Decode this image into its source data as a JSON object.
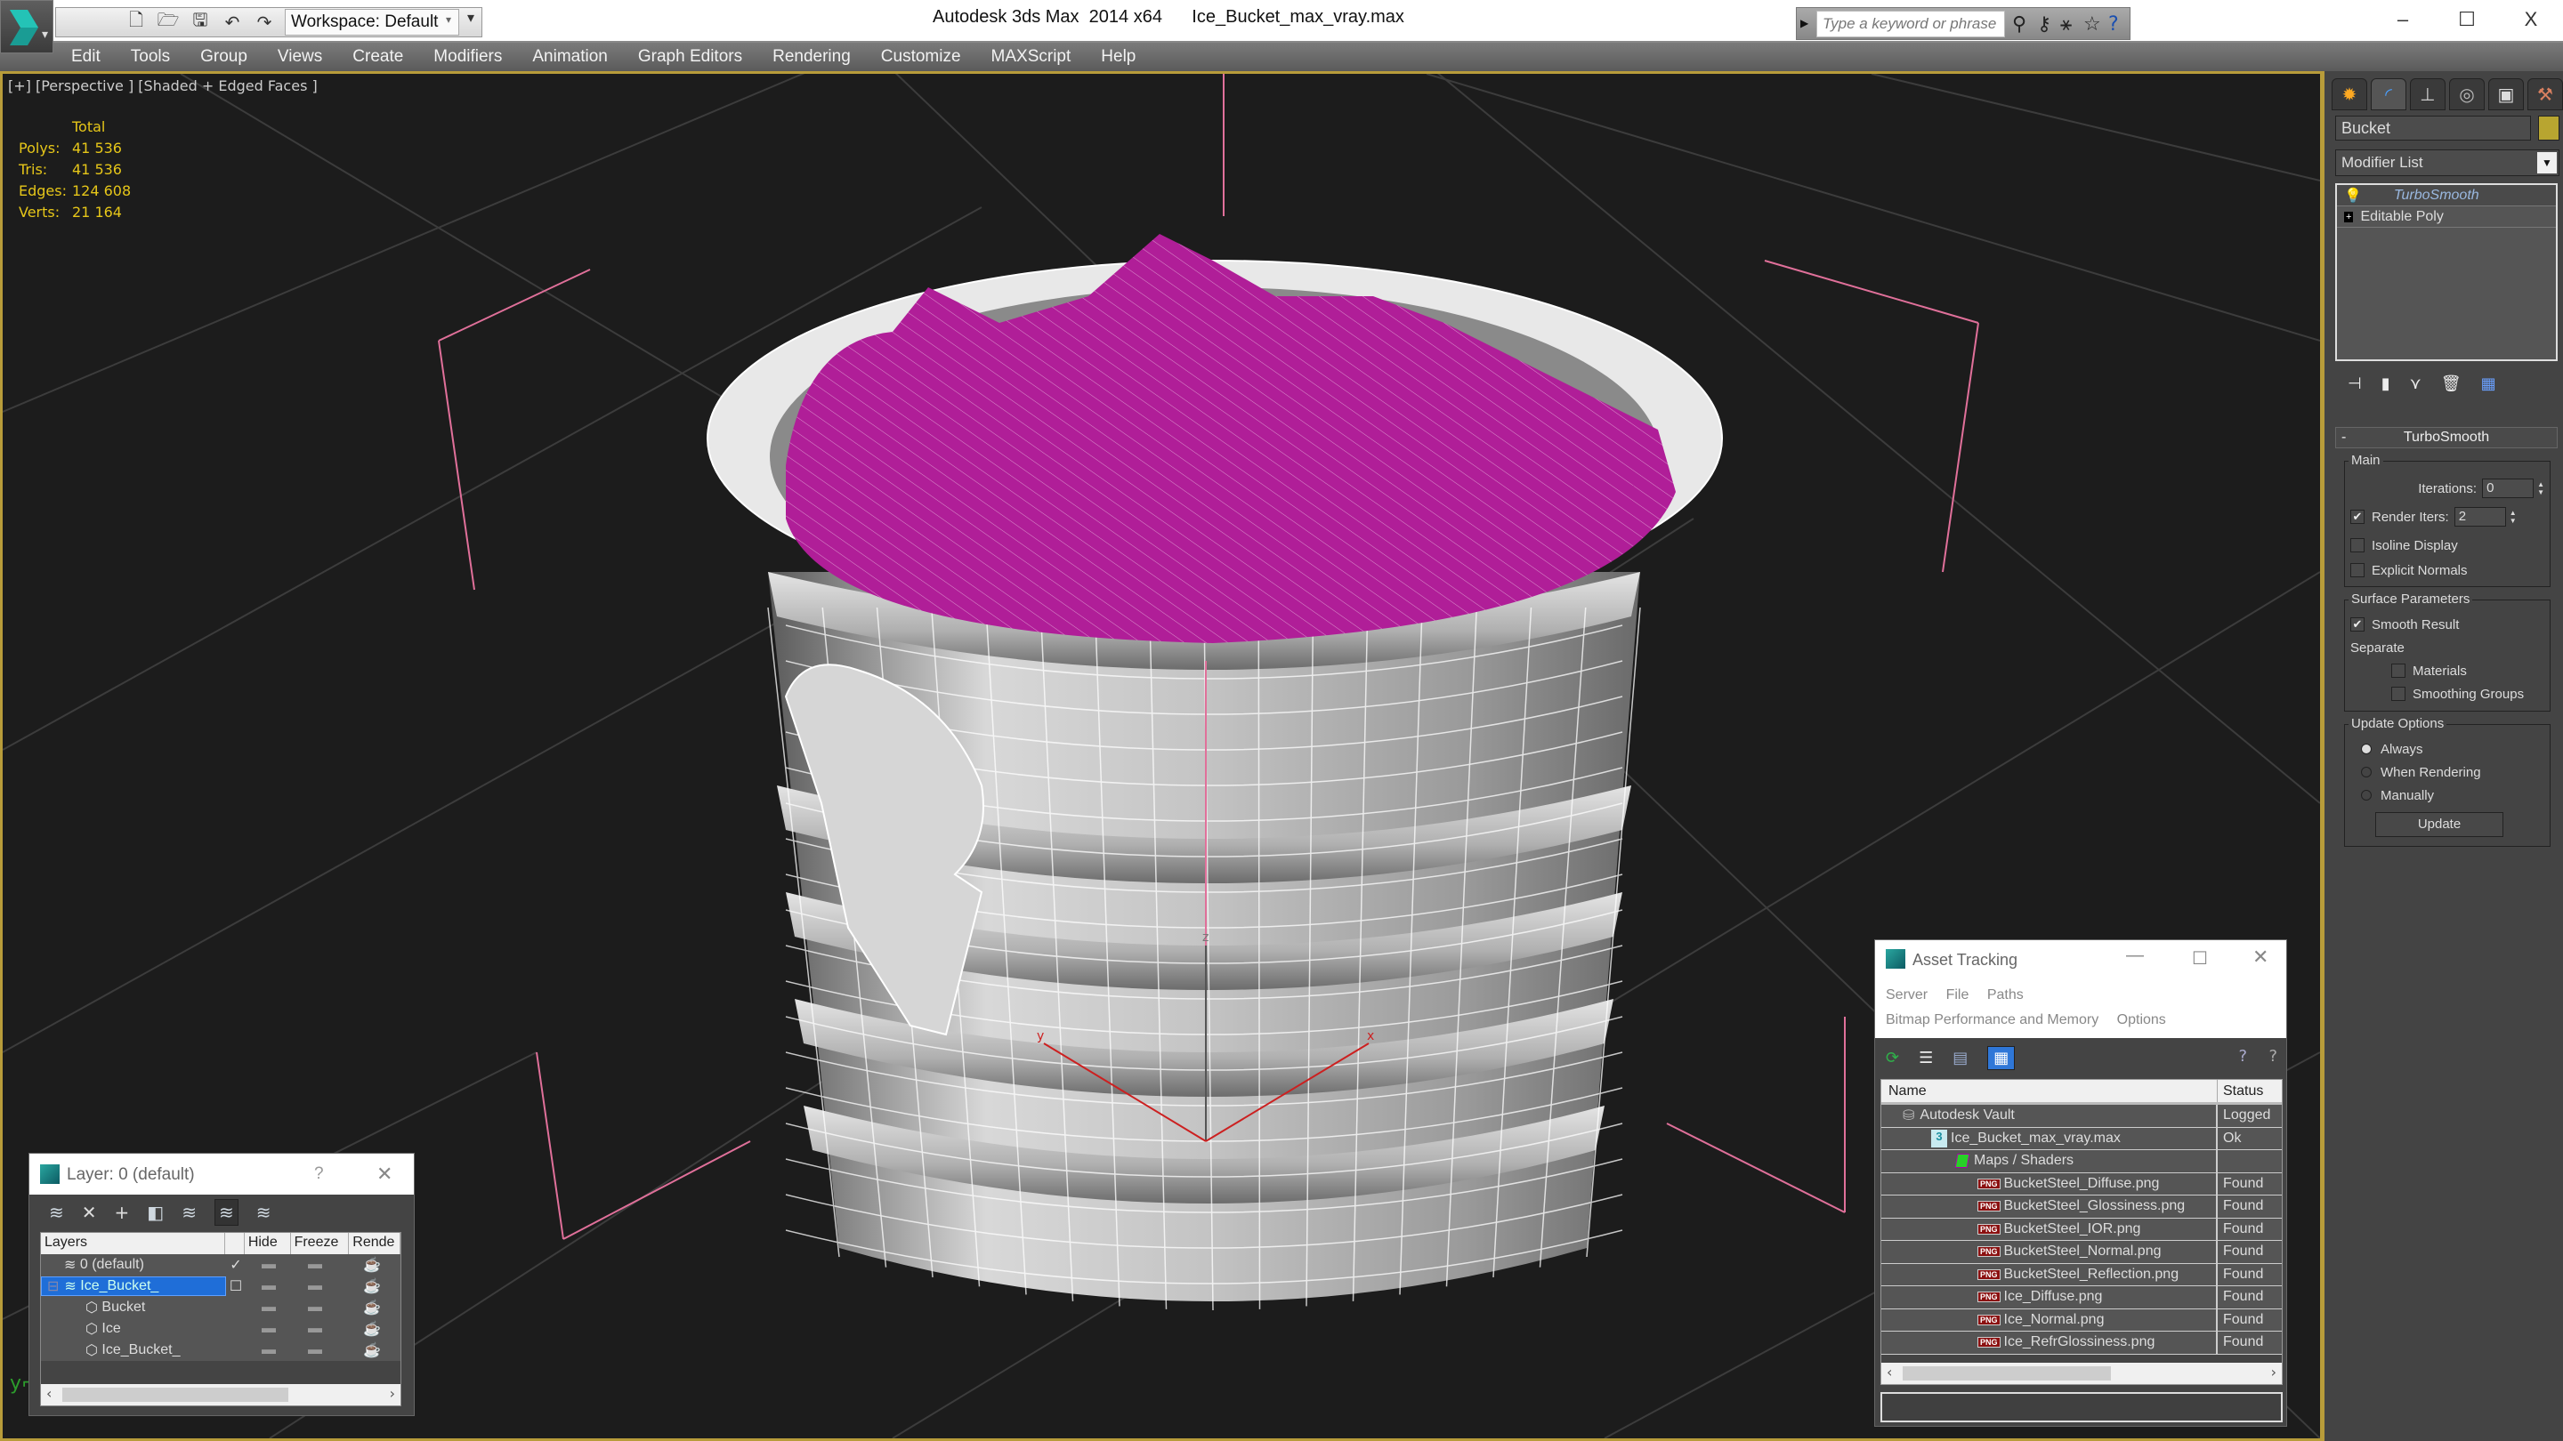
{
  "titlebar": {
    "app_title": "Autodesk 3ds Max  2014 x64",
    "file_name": "Ice_Bucket_max_vray.max",
    "workspace_label": "Workspace: Default",
    "search_placeholder": "Type a keyword or phrase",
    "quick_access": [
      "new-file-icon",
      "open-file-icon",
      "save-icon",
      "undo-icon",
      "redo-icon",
      "project-folder-icon"
    ],
    "infocenter_icons": [
      "binoculars-icon",
      "key-icon",
      "satellite-icon",
      "star-icon",
      "help-icon"
    ],
    "window_controls": {
      "minimize": "–",
      "maximize": "☐",
      "close": "X"
    }
  },
  "menubar": {
    "items": [
      "Edit",
      "Tools",
      "Group",
      "Views",
      "Create",
      "Modifiers",
      "Animation",
      "Graph Editors",
      "Rendering",
      "Customize",
      "MAXScript",
      "Help"
    ]
  },
  "viewport": {
    "label": "[+] [Perspective ] [Shaded + Edged Faces ]",
    "stats": {
      "header": "Total",
      "rows": [
        {
          "label": "Polys:",
          "value": "41 536"
        },
        {
          "label": "Tris:",
          "value": "41 536"
        },
        {
          "label": "Edges:",
          "value": "124 608"
        },
        {
          "label": "Verts:",
          "value": "21 164"
        }
      ]
    },
    "gizmo_axes": {
      "x": "x",
      "y": "y",
      "z": "z"
    },
    "colors": {
      "background": "#1c1c1c",
      "grid": "#3a3a3a",
      "selection_bbox": "#e0709a",
      "ice_wire": "#b01e98",
      "border": "#b89c3a"
    }
  },
  "command_panel": {
    "tabs": [
      "create-tab",
      "modify-tab",
      "hierarchy-tab",
      "motion-tab",
      "display-tab",
      "utilities-tab"
    ],
    "active_tab": "modify-tab",
    "object_name": "Bucket",
    "object_color": "#b8a530",
    "modifier_list_label": "Modifier List",
    "stack": [
      {
        "label": "TurboSmooth",
        "selected": true
      },
      {
        "label": "Editable Poly",
        "selected": false
      }
    ],
    "turbosmooth": {
      "title": "TurboSmooth",
      "main_group": "Main",
      "iterations_label": "Iterations:",
      "iterations_value": "0",
      "render_iters_label": "Render Iters:",
      "render_iters_value": "2",
      "render_iters_checked": true,
      "isoline_label": "Isoline Display",
      "isoline_checked": false,
      "explicit_normals_label": "Explicit Normals",
      "explicit_normals_checked": false,
      "surface_group": "Surface Parameters",
      "smooth_result_label": "Smooth Result",
      "smooth_result_checked": true,
      "separate_label": "Separate",
      "materials_label": "Materials",
      "materials_checked": false,
      "smoothing_groups_label": "Smoothing Groups",
      "smoothing_groups_checked": false,
      "update_group": "Update Options",
      "update_options": [
        "Always",
        "When Rendering",
        "Manually"
      ],
      "update_selected": "Always",
      "update_button": "Update"
    }
  },
  "layer_dialog": {
    "title": "Layer: 0 (default)",
    "help": "?",
    "close": "✕",
    "columns": [
      "Layers",
      "",
      "Hide",
      "Freeze",
      "Rende"
    ],
    "rows": [
      {
        "name": "0 (default)",
        "type": "layer",
        "current": true,
        "selected": false
      },
      {
        "name": "Ice_Bucket_",
        "type": "layer",
        "current": false,
        "selected": true
      },
      {
        "name": "Bucket",
        "type": "object",
        "current": false,
        "selected": false
      },
      {
        "name": "Ice",
        "type": "object",
        "current": false,
        "selected": false
      },
      {
        "name": "Ice_Bucket_",
        "type": "object",
        "current": false,
        "selected": false
      }
    ]
  },
  "asset_dialog": {
    "title": "Asset Tracking",
    "menu_row1": [
      "Server",
      "File",
      "Paths"
    ],
    "menu_row2": [
      "Bitmap Performance and Memory",
      "Options"
    ],
    "columns": [
      "Name",
      "Status"
    ],
    "rows": [
      {
        "name": "Autodesk Vault",
        "status": "Logged",
        "level": 1,
        "icon": "vault"
      },
      {
        "name": "Ice_Bucket_max_vray.max",
        "status": "Ok",
        "level": 2,
        "icon": "max"
      },
      {
        "name": "Maps / Shaders",
        "status": "",
        "level": 3,
        "icon": "maps"
      },
      {
        "name": "BucketSteel_Diffuse.png",
        "status": "Found",
        "level": 4,
        "icon": "png"
      },
      {
        "name": "BucketSteel_Glossiness.png",
        "status": "Found",
        "level": 4,
        "icon": "png"
      },
      {
        "name": "BucketSteel_IOR.png",
        "status": "Found",
        "level": 4,
        "icon": "png"
      },
      {
        "name": "BucketSteel_Normal.png",
        "status": "Found",
        "level": 4,
        "icon": "png"
      },
      {
        "name": "BucketSteel_Reflection.png",
        "status": "Found",
        "level": 4,
        "icon": "png"
      },
      {
        "name": "Ice_Diffuse.png",
        "status": "Found",
        "level": 4,
        "icon": "png"
      },
      {
        "name": "Ice_Normal.png",
        "status": "Found",
        "level": 4,
        "icon": "png"
      },
      {
        "name": "Ice_RefrGlossiness.png",
        "status": "Found",
        "level": 4,
        "icon": "png"
      }
    ]
  }
}
